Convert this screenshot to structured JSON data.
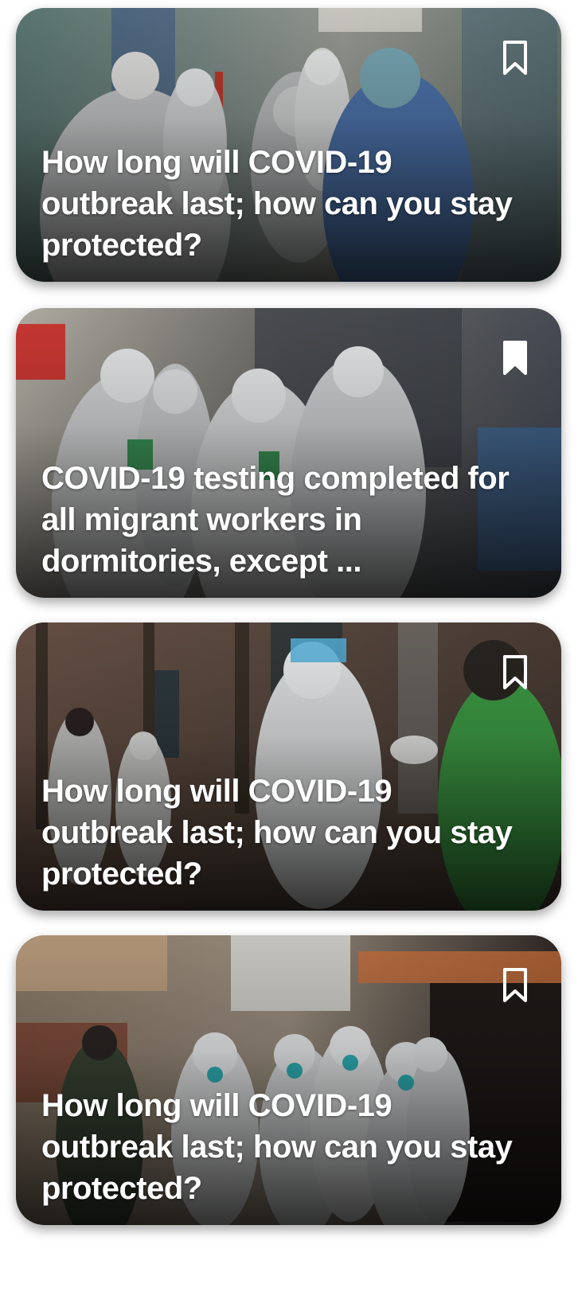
{
  "articles": [
    {
      "headline": "How long will COVID-19 outbreak last; how can you stay protected?",
      "bookmarked": false,
      "photo": "health workers in protective suits walking down a hospital corridor"
    },
    {
      "headline": "COVID-19 testing completed for all migrant workers in dormitories, except ...",
      "bookmarked": true,
      "photo": "health workers in protective suits and face shields gesturing outdoors"
    },
    {
      "headline": "How long will COVID-19 outbreak last; how can you stay protected?",
      "bookmarked": false,
      "photo": "medical worker in protective suit handing a swab to a man in a green shirt"
    },
    {
      "headline": "How long will COVID-19 outbreak last; how can you stay protected?",
      "bookmarked": false,
      "photo": "group of workers in protective suits with face shields outside apartment blocks"
    }
  ],
  "icons": {
    "bookmark": "bookmark-icon"
  },
  "colors": {
    "headline_text": "#ffffff",
    "bookmark_stroke": "#ffffff"
  }
}
